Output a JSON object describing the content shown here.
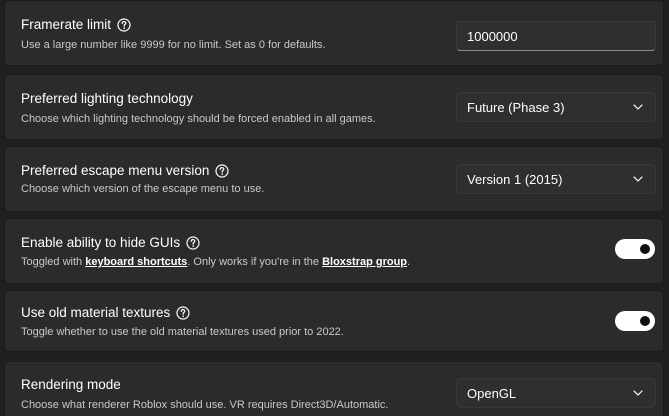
{
  "settings": {
    "framerate": {
      "title": "Framerate limit",
      "description": "Use a large number like 9999 for no limit. Set as 0 for defaults.",
      "value": "1000000"
    },
    "lighting": {
      "title": "Preferred lighting technology",
      "description": "Choose which lighting technology should be forced enabled in all games.",
      "selected": "Future (Phase 3)"
    },
    "escape_menu": {
      "title": "Preferred escape menu version",
      "description": "Choose which version of the escape menu to use.",
      "selected": "Version 1 (2015)"
    },
    "hide_guis": {
      "title": "Enable ability to hide GUIs",
      "desc_part1": "Toggled with ",
      "link1": "keyboard shortcuts",
      "desc_part2": ". Only works if you're in the ",
      "link2": "Bloxstrap group",
      "desc_part3": ".",
      "enabled": true
    },
    "old_textures": {
      "title": "Use old material textures",
      "description": "Toggle whether to use the old material textures used prior to 2022.",
      "enabled": true
    },
    "rendering": {
      "title": "Rendering mode",
      "description": "Choose what renderer Roblox should use. VR requires Direct3D/Automatic.",
      "selected": "OpenGL"
    }
  },
  "icons": {
    "help": "help-circle-icon",
    "chevron": "chevron-down-icon"
  }
}
